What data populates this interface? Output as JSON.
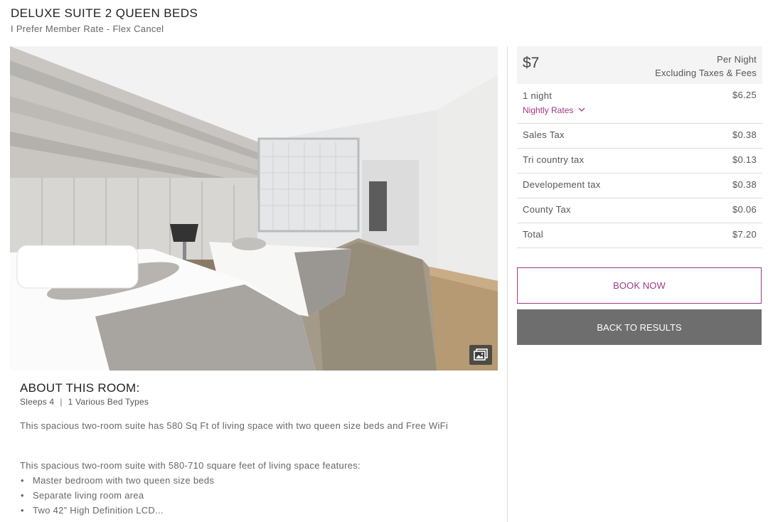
{
  "room": {
    "title": "DELUXE SUITE 2 QUEEN BEDS",
    "rate_name": "I Prefer Member Rate - Flex Cancel"
  },
  "photo": {
    "alt": "Deluxe suite bedroom with two queen beds",
    "gallery_icon": "gallery-icon"
  },
  "about": {
    "heading": "ABOUT THIS ROOM:",
    "sleeps": "Sleeps 4",
    "separator": "|",
    "bed_types": "1 Various Bed Types",
    "description": "This spacious two-room suite has 580 Sq Ft of living space with two queen size beds and Free WiFi",
    "features_intro": "This spacious two-room suite with 580-710 square feet of living space features:",
    "features": [
      "Master bedroom with two queen size beds",
      "Separate living room area",
      "Two 42” High Definition LCD..."
    ]
  },
  "pricing": {
    "headline_price": "$7",
    "per_night": "Per Night",
    "excluding": "Excluding Taxes & Fees",
    "nights_label": "1 night",
    "nights_amount": "$6.25",
    "nightly_rates_link": "Nightly Rates",
    "rows": [
      {
        "label": "Sales Tax",
        "amount": "$0.38"
      },
      {
        "label": "Tri country tax",
        "amount": "$0.13"
      },
      {
        "label": "Developement tax",
        "amount": "$0.38"
      },
      {
        "label": "County Tax",
        "amount": "$0.06"
      },
      {
        "label": "Total",
        "amount": "$7.20"
      }
    ]
  },
  "actions": {
    "book_now": "BOOK NOW",
    "back_to_results": "BACK TO RESULTS"
  },
  "colors": {
    "accent": "#9c3a7f",
    "secondary_button": "#6e6e6e",
    "price_header_bg": "#f4f4f4"
  }
}
